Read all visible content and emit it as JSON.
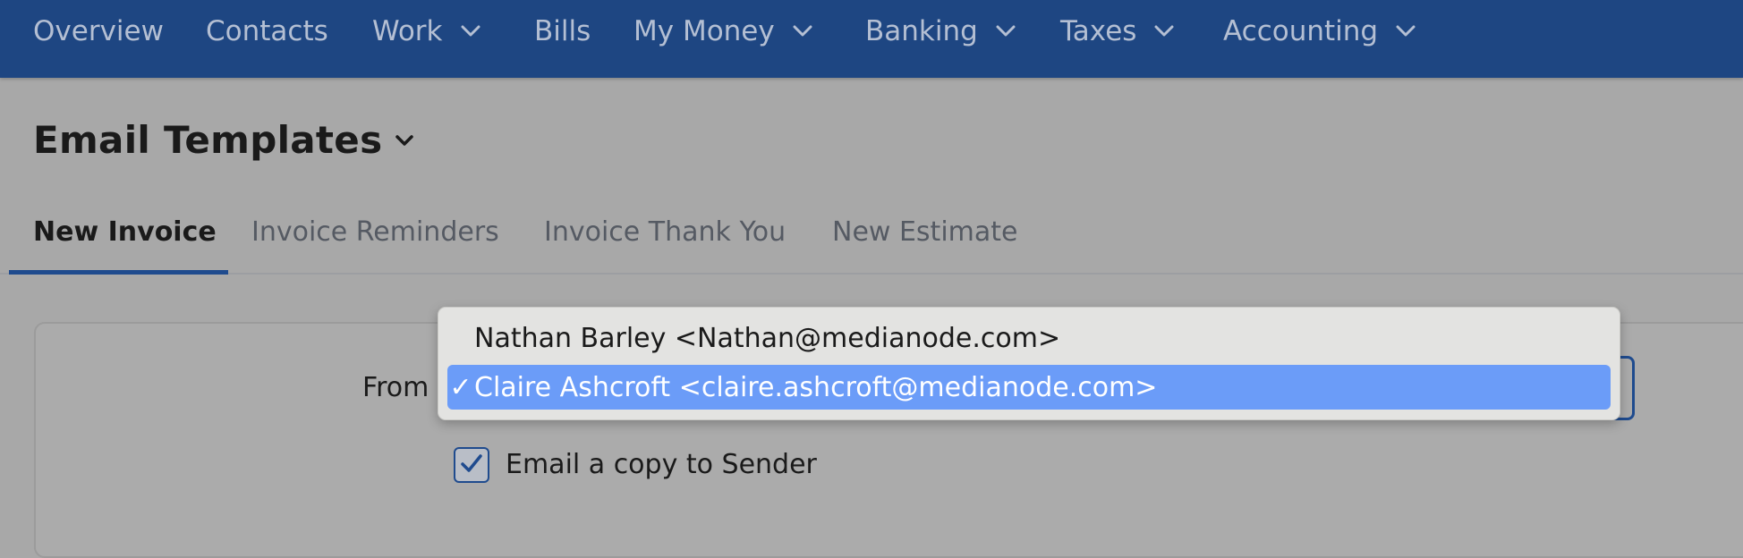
{
  "nav": {
    "items": [
      {
        "label": "Overview",
        "has_menu": false
      },
      {
        "label": "Contacts",
        "has_menu": false
      },
      {
        "label": "Work",
        "has_menu": true
      },
      {
        "label": "Bills",
        "has_menu": false
      },
      {
        "label": "My Money",
        "has_menu": true
      },
      {
        "label": "Banking",
        "has_menu": true
      },
      {
        "label": "Taxes",
        "has_menu": true
      },
      {
        "label": "Accounting",
        "has_menu": true
      }
    ]
  },
  "page": {
    "title": "Email Templates"
  },
  "tabs": [
    {
      "label": "New Invoice",
      "active": true
    },
    {
      "label": "Invoice Reminders",
      "active": false
    },
    {
      "label": "Invoice Thank You",
      "active": false
    },
    {
      "label": "New Estimate",
      "active": false
    }
  ],
  "form": {
    "from_label": "From",
    "from_options": [
      {
        "label": "Nathan Barley <Nathan@medianode.com>",
        "selected": false
      },
      {
        "label": "Claire Ashcroft <claire.ashcroft@medianode.com>",
        "selected": true
      }
    ],
    "check_glyph": "✓",
    "copy_to_sender": {
      "label": "Email a copy to Sender",
      "checked": true
    }
  },
  "colors": {
    "nav_bg": "#1e4682",
    "accent": "#1f4b8e",
    "selection": "#6b9cf8"
  }
}
